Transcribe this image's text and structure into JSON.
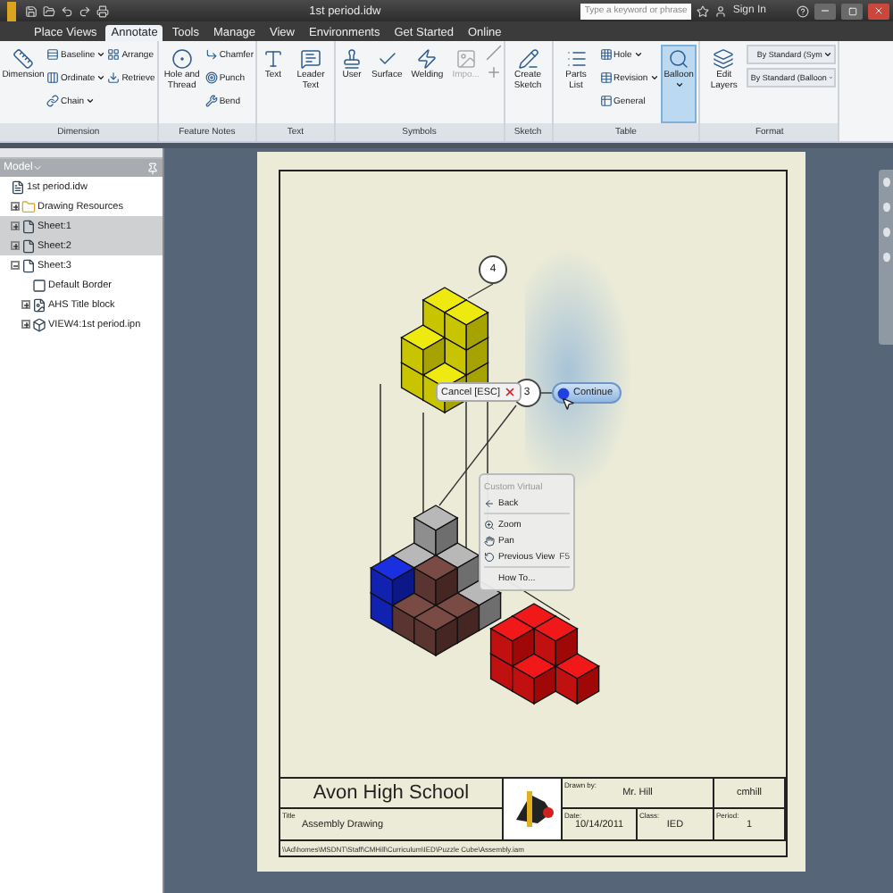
{
  "title_bar": {
    "document": "1st period.idw",
    "search": {
      "placeholder": "Type a keyword or phrase"
    },
    "sign_in": "Sign In"
  },
  "tabs": [
    {
      "label": "Place Views",
      "selected": false
    },
    {
      "label": "Annotate",
      "selected": true
    },
    {
      "label": "Tools",
      "selected": false
    },
    {
      "label": "Manage",
      "selected": false
    },
    {
      "label": "View",
      "selected": false
    },
    {
      "label": "Environments",
      "selected": false
    },
    {
      "label": "Get Started",
      "selected": false
    },
    {
      "label": "Online",
      "selected": false
    }
  ],
  "ribbon": [
    {
      "label": "Dimension",
      "columns": [
        [
          {
            "kind": "large",
            "label": "Dimension"
          }
        ],
        [
          {
            "kind": "small",
            "label": "Baseline",
            "dropdown": true
          },
          {
            "kind": "small",
            "label": "Ordinate",
            "dropdown": true
          },
          {
            "kind": "small",
            "label": "Chain",
            "dropdown": true
          }
        ],
        [
          {
            "kind": "small",
            "label": "Arrange"
          },
          {
            "kind": "small",
            "label": "Retrieve"
          }
        ]
      ]
    },
    {
      "label": "Feature Notes",
      "columns": [
        [
          {
            "kind": "large",
            "label": "Hole and Thread"
          }
        ],
        [
          {
            "kind": "small",
            "label": "Chamfer"
          },
          {
            "kind": "small",
            "label": "Punch"
          },
          {
            "kind": "small",
            "label": "Bend"
          }
        ]
      ]
    },
    {
      "label": "Text",
      "columns": [
        [
          {
            "kind": "large",
            "label": "Text"
          }
        ],
        [
          {
            "kind": "large",
            "label": "Leader Text"
          }
        ]
      ]
    },
    {
      "label": "Symbols",
      "columns": [
        [
          {
            "kind": "large",
            "label": "User"
          }
        ],
        [
          {
            "kind": "large",
            "label": "Surface"
          }
        ],
        [
          {
            "kind": "large",
            "label": "Welding"
          }
        ],
        [
          {
            "kind": "large",
            "label": "Impo...",
            "disabled": true
          }
        ],
        [
          {
            "kind": "icon"
          },
          {
            "kind": "icon"
          }
        ]
      ]
    },
    {
      "label": "Sketch",
      "columns": [
        [
          {
            "kind": "large",
            "label": "Create Sketch"
          }
        ]
      ]
    },
    {
      "label": "Table",
      "columns": [
        [
          {
            "kind": "large",
            "label": "Parts List"
          }
        ],
        [
          {
            "kind": "small",
            "label": "Hole",
            "dropdown": true
          },
          {
            "kind": "small",
            "label": "Revision",
            "dropdown": true
          },
          {
            "kind": "small",
            "label": "General"
          }
        ],
        [
          {
            "kind": "large",
            "label": "Balloon",
            "dropdown": true,
            "selected": true
          }
        ]
      ]
    },
    {
      "label": "Format",
      "columns": [
        [
          {
            "kind": "large",
            "label": "Edit Layers"
          }
        ],
        [
          {
            "kind": "dropdown",
            "label": "By Standard (Sym"
          },
          {
            "kind": "dropdown",
            "label": "By Standard (Balloon"
          }
        ]
      ]
    }
  ],
  "browser": {
    "header": "Model",
    "tree": [
      {
        "kind": "document",
        "label": "1st period.idw",
        "children": [
          {
            "kind": "folder",
            "label": "Drawing Resources",
            "expanded": false,
            "selected": false
          },
          {
            "kind": "sheet",
            "label": "Sheet:1",
            "expanded": false,
            "selected": true
          },
          {
            "kind": "sheet",
            "label": "Sheet:2",
            "expanded": false,
            "selected": true
          },
          {
            "kind": "sheet",
            "label": "Sheet:3",
            "expanded": true,
            "selected": false,
            "children": [
              {
                "kind": "border",
                "label": "Default Border",
                "selected": false
              },
              {
                "kind": "titleblock",
                "label": "AHS Title block",
                "expanded": false,
                "selected": false
              },
              {
                "kind": "view",
                "label": "VIEW4:1st period.ipn",
                "expanded": false,
                "selected": false
              }
            ]
          }
        ]
      }
    ]
  },
  "balloons": [
    "4",
    "3"
  ],
  "marking_menu": {
    "cancel": "Cancel [ESC]",
    "continue": "Continue"
  },
  "context_menu": [
    {
      "kind": "header",
      "label": "Custom Virtual"
    },
    {
      "kind": "command",
      "label": "Back"
    },
    {
      "kind": "separator"
    },
    {
      "kind": "command",
      "label": "Zoom"
    },
    {
      "kind": "command",
      "label": "Pan"
    },
    {
      "kind": "command",
      "label": "Previous View",
      "shortcut": "F5"
    },
    {
      "kind": "separator"
    },
    {
      "kind": "command",
      "label": "How To..."
    }
  ],
  "title_block": {
    "school": "Avon High School",
    "drawn_by_label": "Drawn by:",
    "drawn_by": "Mr. Hill",
    "user": "cmhill",
    "title_label": "Title",
    "title": "Assembly Drawing",
    "date_label": "Date:",
    "date": "10/14/2011",
    "class_label": "Class:",
    "class": "IED",
    "period_label": "Period:",
    "period": "1"
  },
  "file_path": "\\\\Ad\\homes\\MSDNT\\Staff\\CMHill\\Curriculum\\IED\\Puzzle Cube\\Assembly.iam"
}
